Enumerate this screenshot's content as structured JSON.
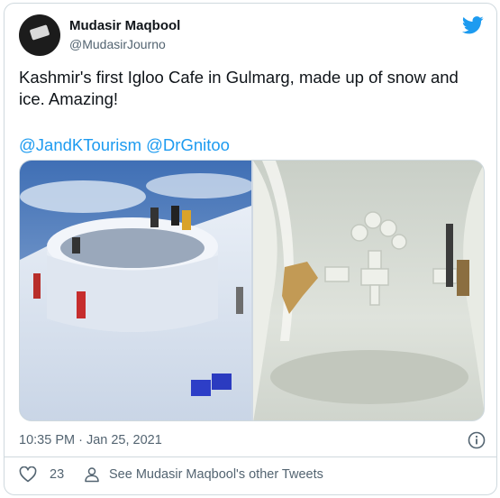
{
  "author": {
    "display_name": "Mudasir Maqbool",
    "handle": "@MudasirJourno"
  },
  "tweet": {
    "text": "Kashmir's first Igloo Cafe in Gulmarg, made up of snow and ice. Amazing!",
    "mentions": [
      "@JandKTourism",
      "@DrGnitoo"
    ],
    "timestamp": "10:35 PM · Jan 25, 2021"
  },
  "actions": {
    "like_count": "23",
    "other_tweets_label": "See Mudasir Maqbool's other Tweets"
  },
  "colors": {
    "brand_blue": "#1d9bf0",
    "secondary_text": "#536471",
    "border": "#cfd9de"
  },
  "icons": {
    "brand": "twitter-bird-icon",
    "info": "info-icon",
    "like": "heart-icon",
    "profile": "person-icon"
  }
}
